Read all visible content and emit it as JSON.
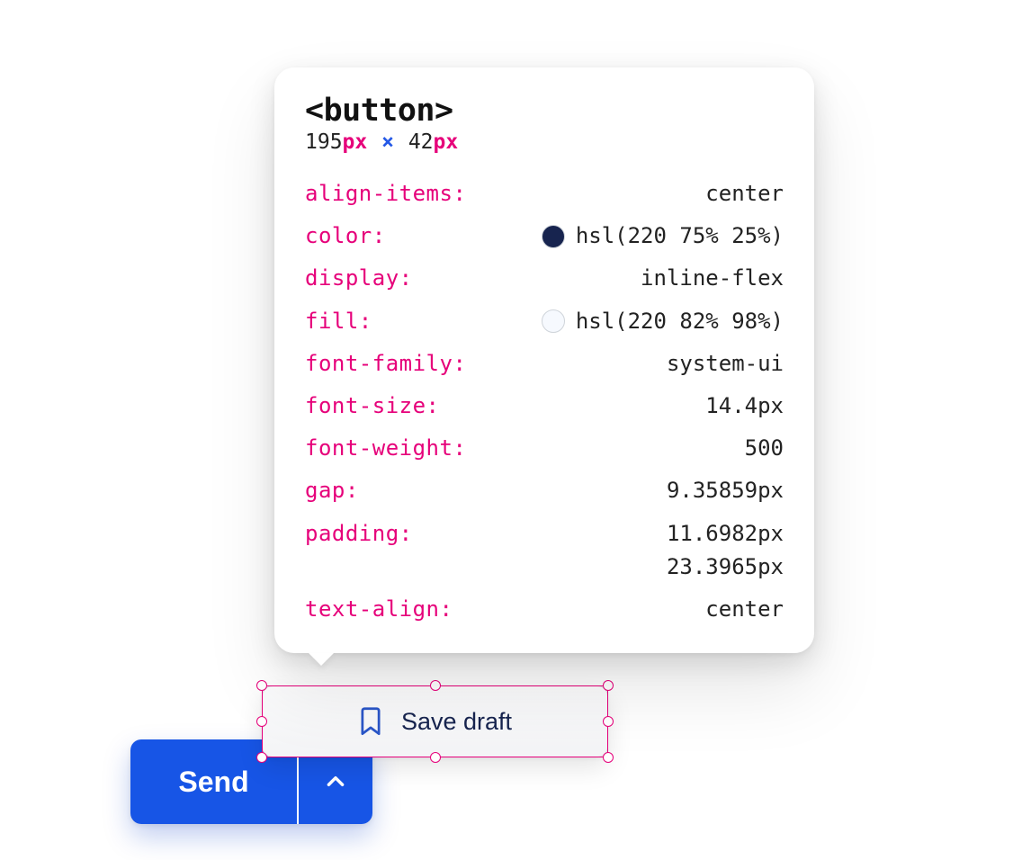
{
  "inspector": {
    "element_tag": "<button>",
    "dimensions": {
      "width_num": "195",
      "width_unit": "px",
      "times": "×",
      "height_num": "42",
      "height_unit": "px"
    },
    "props": [
      {
        "key": "align-items",
        "value": "center"
      },
      {
        "key": "color",
        "value": "hsl(220 75% 25%)",
        "swatch": "#17244f"
      },
      {
        "key": "display",
        "value": "inline-flex"
      },
      {
        "key": "fill",
        "value": "hsl(220 82% 98%)",
        "swatch": "#f6f9fe"
      },
      {
        "key": "font-family",
        "value": "system-ui"
      },
      {
        "key": "font-size",
        "value": "14.4px"
      },
      {
        "key": "font-weight",
        "value": "500"
      },
      {
        "key": "gap",
        "value": "9.35859px"
      },
      {
        "key": "padding",
        "value": "11.6982px",
        "value2": "23.3965px"
      },
      {
        "key": "text-align",
        "value": "center"
      }
    ]
  },
  "popover": {
    "save_draft_label": "Save draft"
  },
  "send": {
    "label": "Send"
  }
}
